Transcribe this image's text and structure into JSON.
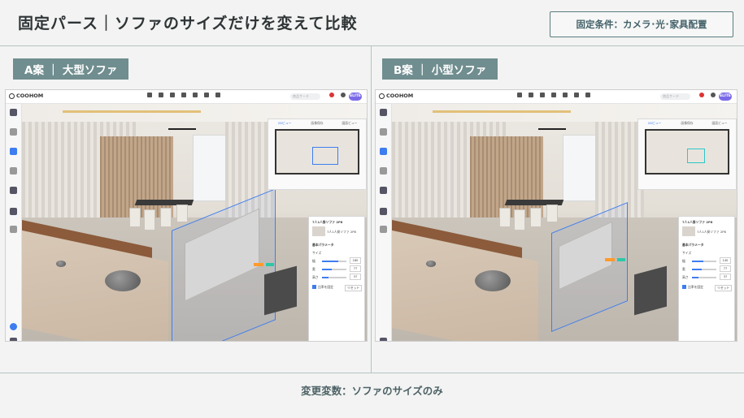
{
  "header": {
    "title": "固定パース｜ソファのサイズだけを変えて比較",
    "condition": "固定条件：カメラ･光･家具配置"
  },
  "panels": [
    {
      "label": "A案 ｜ 大型ソファ",
      "app": {
        "logo": "COOHOM",
        "search_placeholder": "商品サーチ",
        "elite_badge": "ELITE",
        "minimap_tabs": [
          "2Dビュー",
          "画像保存",
          "図面ビュー"
        ],
        "product_title": "7人1人掛ソファ 2P8",
        "product_sub": "7人1人掛ソファ 2P8",
        "section_label": "基本パラメータ",
        "size_label": "サイズ",
        "width_label": "幅",
        "width_value": "180",
        "depth_label": "奥",
        "depth_value": "77",
        "height_label": "高さ",
        "height_value": "37",
        "checkbox_label": "比率を固定",
        "reset_label": "リセット",
        "view_mode": "3D"
      }
    },
    {
      "label": "B案 ｜ 小型ソファ",
      "app": {
        "logo": "COOHOM",
        "search_placeholder": "商品サーチ",
        "elite_badge": "ELITE",
        "minimap_tabs": [
          "2Dビュー",
          "画像保存",
          "図面ビュー"
        ],
        "product_title": "7人1人掛ソファ 2P8",
        "product_sub": "7人1人掛ソファ 2P8",
        "section_label": "基本パラメータ",
        "size_label": "サイズ",
        "width_label": "幅",
        "width_value": "140",
        "depth_label": "奥",
        "depth_value": "77",
        "height_label": "高さ",
        "height_value": "37",
        "checkbox_label": "比率を固定",
        "reset_label": "リセット",
        "view_mode": "3D"
      }
    }
  ],
  "footer": {
    "text": "変更変数：ソファのサイズのみ"
  },
  "colors": {
    "accent": "#708d8f",
    "selection": "#3d7df0",
    "elite": "#7a6ae8"
  }
}
